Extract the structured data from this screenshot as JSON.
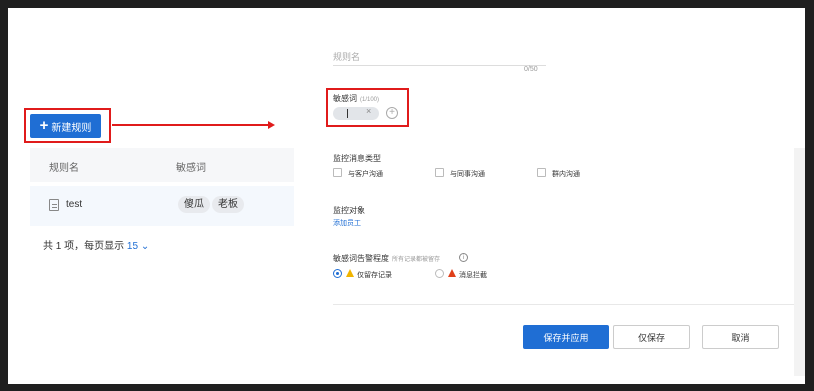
{
  "left": {
    "new_rule_button": "新建规则",
    "table": {
      "headers": [
        "规则名",
        "敏感词"
      ],
      "rows": [
        {
          "name": "test",
          "words": [
            "傻瓜",
            "老板"
          ]
        }
      ]
    },
    "pager": {
      "prefix": "共 1 项，每页显示",
      "page_size": "15"
    }
  },
  "form": {
    "name_placeholder": "规则名",
    "name_counter": "0/50",
    "sensitive_label": "敏感词",
    "sensitive_count": "(1/100)",
    "msgtype_label": "监控消息类型",
    "msgtypes": [
      "与客户沟通",
      "与同事沟通",
      "群内沟通"
    ],
    "target_label": "监控对象",
    "add_staff": "添加员工",
    "alert_label": "敏感词告警程度",
    "alert_hint": "所有记录都被留存",
    "alert_options": [
      "仅留存记录",
      "消息拦截"
    ],
    "buttons": {
      "save_apply": "保存并应用",
      "save_only": "仅保存",
      "cancel": "取消"
    }
  },
  "colors": {
    "accent": "#1f6ed4",
    "highlight_red": "#e01b1b"
  }
}
